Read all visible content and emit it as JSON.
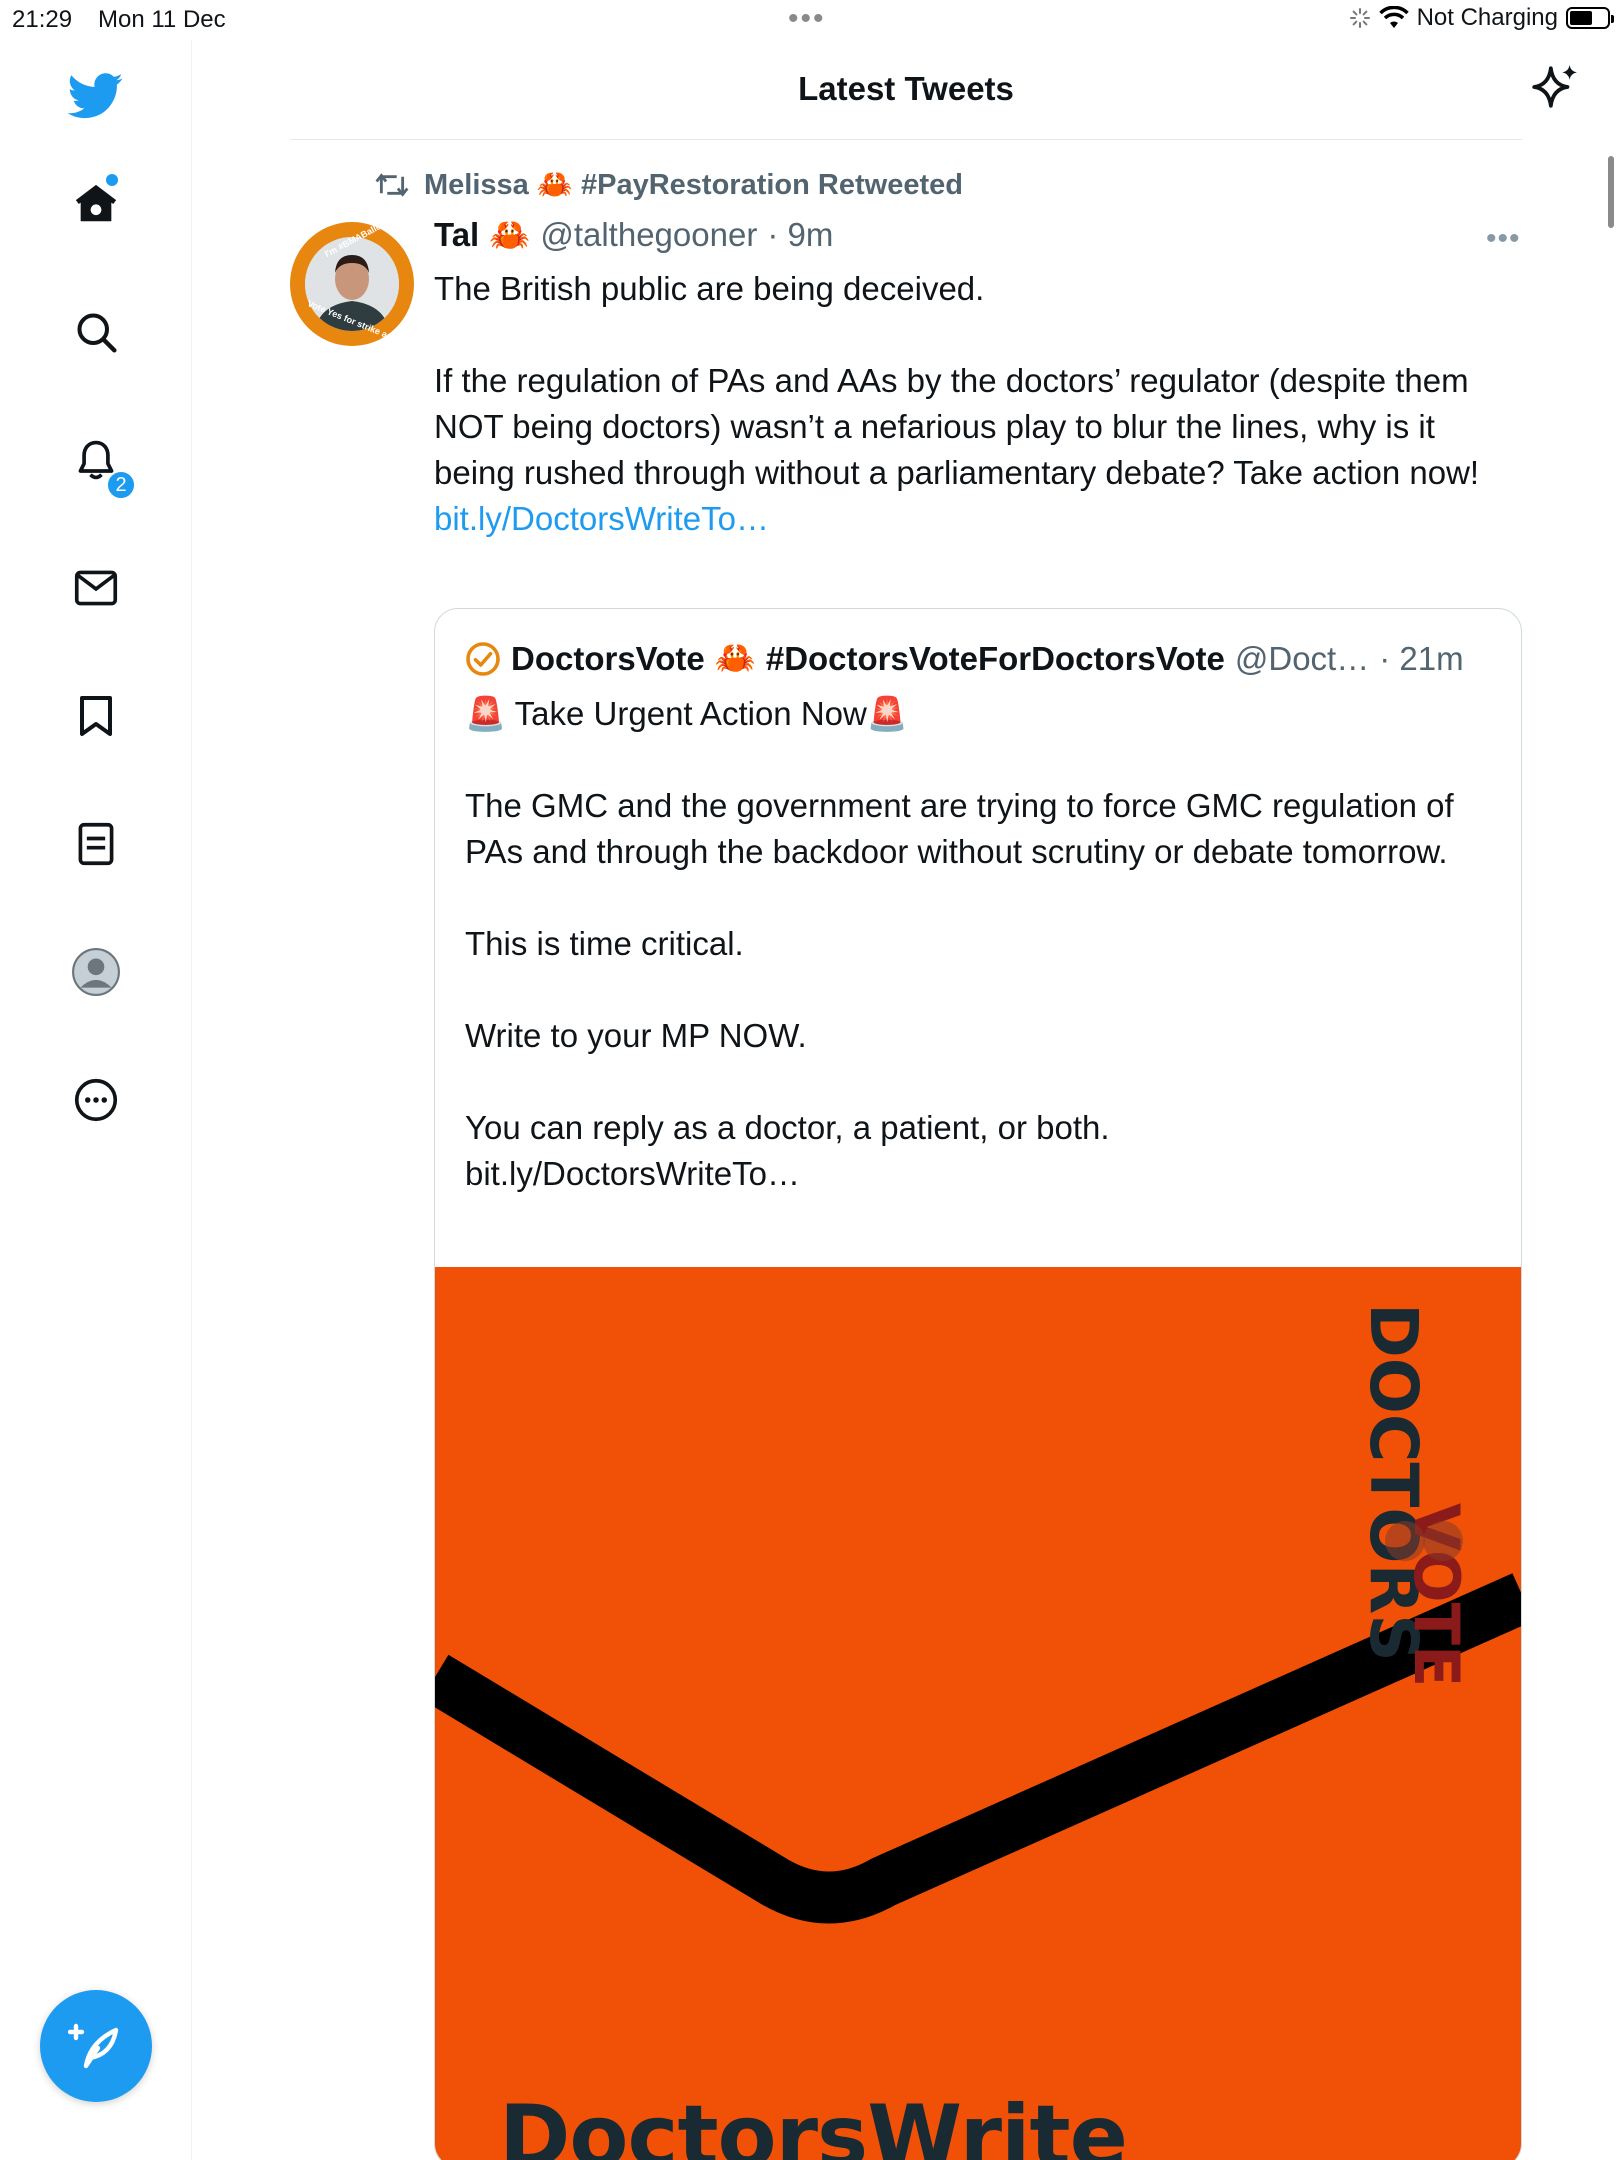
{
  "status_bar": {
    "time": "21:29",
    "date": "Mon 11 Dec",
    "charging": "Not Charging"
  },
  "sidebar": {
    "notification_count": "2"
  },
  "header": {
    "title": "Latest Tweets"
  },
  "tweet": {
    "retweeted_by": "Melissa 🦀 #PayRestoration Retweeted",
    "author_name": "Tal",
    "author_emoji": "🦀",
    "author_handle": "@talthegooner",
    "time": "· 9m",
    "line1": "The British public are being deceived.",
    "line2": "If the regulation of PAs and AAs by the doctors’ regulator (despite them NOT being doctors) wasn’t a nefarious play to blur the lines, why is it being rushed through without a parliamentary debate?  Take action now!",
    "link": "bit.ly/DoctorsWriteTo…",
    "avatar_ring_top": "I'm #BMABallotReady",
    "avatar_ring_bottom": "Vote Yes for strike action"
  },
  "quote": {
    "name": "DoctorsVote",
    "emoji": "🦀",
    "hashtag": "#DoctorsVoteForDoctorsVote",
    "handle": "@Doct…",
    "time": "· 21m",
    "headline": "🚨 Take Urgent Action Now🚨",
    "para1": "The GMC and the government are trying to force GMC regulation of PAs and through the backdoor without scrutiny or debate tomorrow.",
    "para2": "This is time critical.",
    "para3": "Write to your MP NOW.",
    "para4": "You can reply as a doctor, a patient, or both.",
    "link": "bit.ly/DoctorsWriteTo…",
    "image": {
      "brand_text": "DoctorsWrite",
      "logo_word1": "DOCTORS",
      "logo_word2": "VOTE",
      "background_color": "#f05107"
    }
  },
  "colors": {
    "accent": "#1d9bf0",
    "secondary_text": "#536471",
    "border": "#cfd9de"
  }
}
